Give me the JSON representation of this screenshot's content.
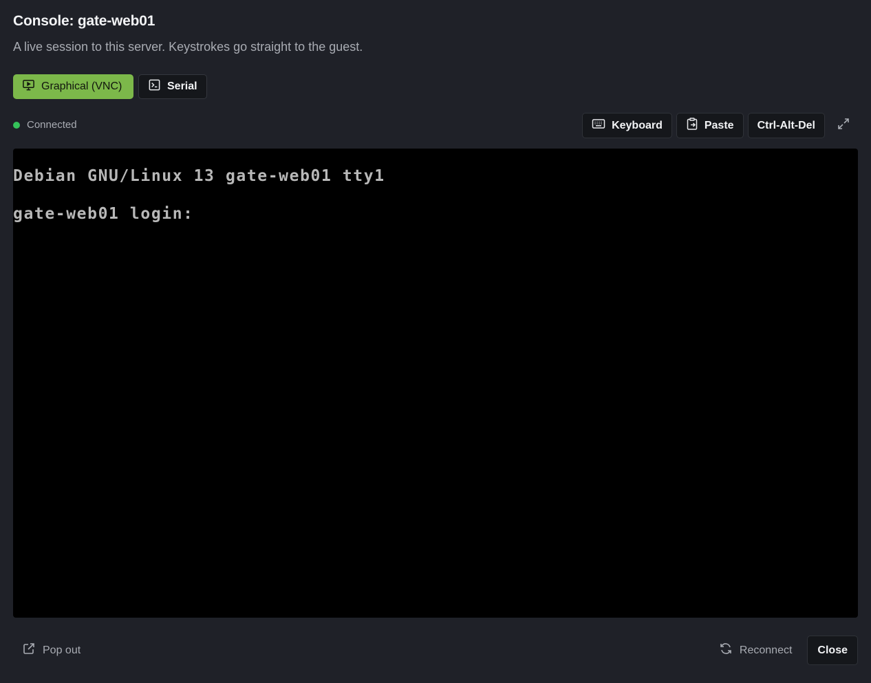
{
  "header": {
    "title": "Console: gate-web01",
    "subtitle": "A live session to this server. Keystrokes go straight to the guest."
  },
  "mode_tabs": [
    {
      "label": "Graphical (VNC)",
      "icon": "monitor-play-icon",
      "active": true
    },
    {
      "label": "Serial",
      "icon": "terminal-icon",
      "active": false
    }
  ],
  "status": {
    "label": "Connected",
    "color": "#35c25a"
  },
  "toolbar": {
    "keyboard_label": "Keyboard",
    "paste_label": "Paste",
    "ctrl_alt_del_label": "Ctrl-Alt-Del",
    "fullscreen_icon": "expand-icon"
  },
  "console": {
    "lines": [
      "Debian GNU/Linux 13 gate-web01 tty1",
      "gate-web01 login:"
    ]
  },
  "footer": {
    "pop_out_label": "Pop out",
    "reconnect_label": "Reconnect",
    "close_label": "Close"
  },
  "colors": {
    "background": "#1f2128",
    "accent": "#7cb84a",
    "console_text": "#b8b8b8"
  }
}
